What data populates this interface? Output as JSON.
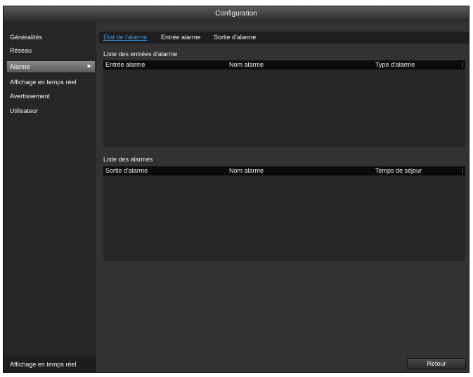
{
  "window": {
    "title": "Configuration"
  },
  "sidebar": {
    "items": [
      {
        "label": "Généralités"
      },
      {
        "label": "Réseau"
      },
      {
        "label": "Alarme"
      },
      {
        "label": "Affichage en temps réel"
      },
      {
        "label": "Avertissement"
      },
      {
        "label": "Utilisateur"
      }
    ],
    "active_index": 2,
    "active_arrow": "▶",
    "bottom_label": "Affichage en temps réel"
  },
  "tabs": [
    {
      "label": "État de l'alarme"
    },
    {
      "label": "Entrée alarme"
    },
    {
      "label": "Sortie d'alarme"
    }
  ],
  "alarm_inputs": {
    "title": "Liste des entrées d'alarme",
    "columns": [
      "Entrée alarme",
      "Nom alarme",
      "Type d'alarme"
    ],
    "rows": []
  },
  "alarm_outputs": {
    "title": "Liste des alarmes",
    "columns": [
      "Sortie d'alarme",
      "Nom alarme",
      "Temps de séjour"
    ],
    "rows": []
  },
  "buttons": {
    "back": "Retour"
  }
}
